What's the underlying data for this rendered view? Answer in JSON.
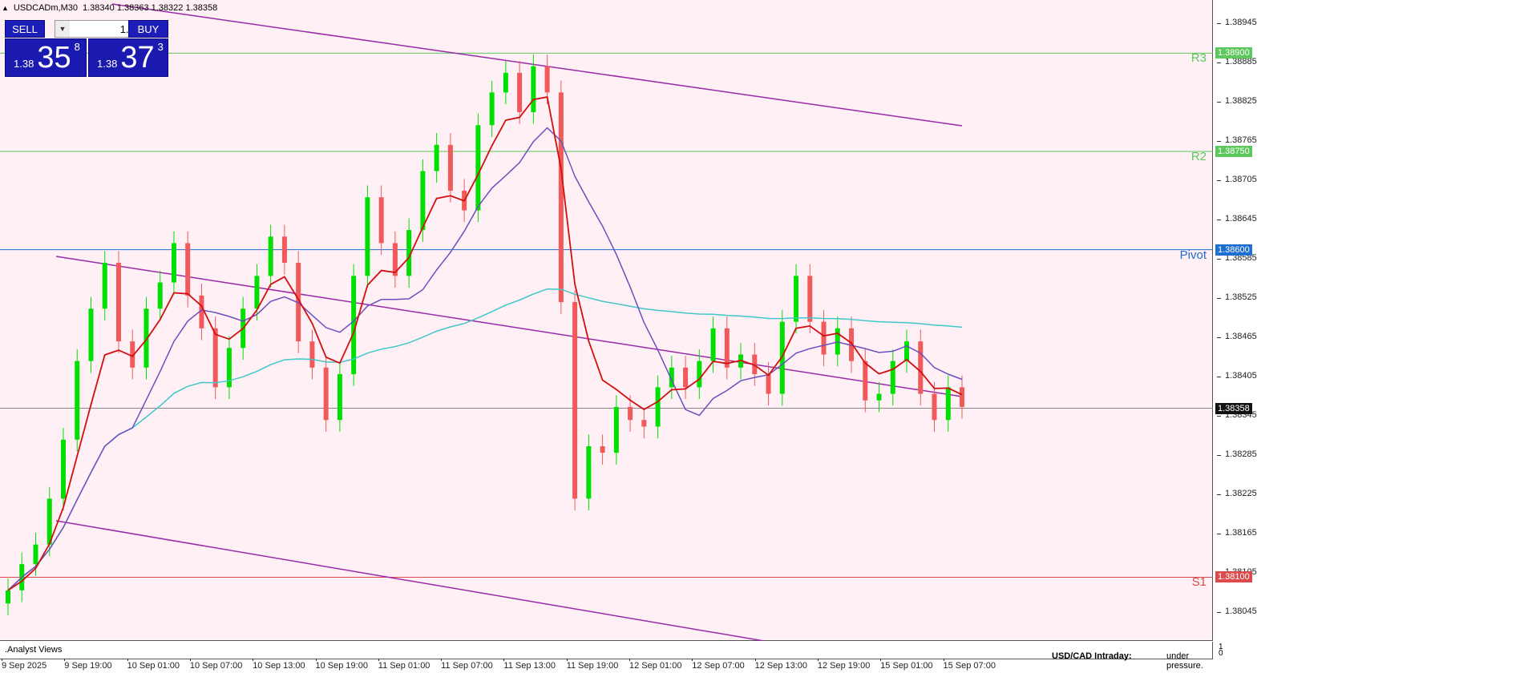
{
  "window": {
    "symbol_title": "USDCADm,M30",
    "ohlc": "1.38340 1.38363 1.38322 1.38358"
  },
  "trade_panel": {
    "sell_label": "SELL",
    "buy_label": "BUY",
    "lot_value": "1.00",
    "sell_quote": {
      "prefix": "1.38",
      "big": "35",
      "sup": "8"
    },
    "buy_quote": {
      "prefix": "1.38",
      "big": "37",
      "sup": "3"
    }
  },
  "price_axis": {
    "ticks": [
      "1.38945",
      "1.38885",
      "1.38825",
      "1.38765",
      "1.38705",
      "1.38645",
      "1.38585",
      "1.38525",
      "1.38465",
      "1.38405",
      "1.38345",
      "1.38285",
      "1.38225",
      "1.38165",
      "1.38105",
      "1.38045"
    ]
  },
  "levels": [
    {
      "name": "R3",
      "price": "1.38900",
      "color": "#5dc85d"
    },
    {
      "name": "R2",
      "price": "1.38750",
      "color": "#5dc85d"
    },
    {
      "name": "Pivot",
      "price": "1.38600",
      "color": "#1e6fd0"
    },
    {
      "name": "S1",
      "price": "1.38100",
      "color": "#dc4b4b"
    }
  ],
  "current_price": "1.38358",
  "time_axis": {
    "labels": [
      "9 Sep 2025",
      "9 Sep 19:00",
      "10 Sep 01:00",
      "10 Sep 07:00",
      "10 Sep 13:00",
      "10 Sep 19:00",
      "11 Sep 01:00",
      "11 Sep 07:00",
      "11 Sep 13:00",
      "11 Sep 19:00",
      "12 Sep 01:00",
      "12 Sep 07:00",
      "12 Sep 13:00",
      "12 Sep 19:00",
      "15 Sep 01:00",
      "15 Sep 07:00"
    ]
  },
  "sub_panel": {
    "label": ".Analyst Views",
    "news_title": "USD/CAD Intraday:",
    "news_text": "under pressure.",
    "scale_top": "1",
    "scale_bottom": "0"
  },
  "colors": {
    "bull": "#00e000",
    "bear": "#f05a5a",
    "ema_fast": "#d01010",
    "ma_mid": "#6a4fc0",
    "ma_slow": "#40c8c8",
    "channel": "#9a2aa8",
    "background": "#fff0f5"
  },
  "chart_data": {
    "type": "candlestick",
    "timeframe": "M30",
    "y_range": [
      1.38015,
      1.38975
    ],
    "close_series": [
      1.3808,
      1.3812,
      1.3815,
      1.3822,
      1.3831,
      1.3843,
      1.3851,
      1.3858,
      1.3846,
      1.3842,
      1.3851,
      1.3855,
      1.3861,
      1.3853,
      1.3848,
      1.3839,
      1.3845,
      1.3851,
      1.3856,
      1.3862,
      1.3858,
      1.3846,
      1.3842,
      1.3834,
      1.3841,
      1.3856,
      1.3868,
      1.3861,
      1.3856,
      1.3863,
      1.3872,
      1.3876,
      1.3869,
      1.3866,
      1.3879,
      1.3884,
      1.3887,
      1.3881,
      1.3888,
      1.3884,
      1.3852,
      1.3822,
      1.383,
      1.3829,
      1.3836,
      1.3834,
      1.3833,
      1.3839,
      1.3842,
      1.3839,
      1.3843,
      1.3848,
      1.3842,
      1.3844,
      1.3841,
      1.3838,
      1.3849,
      1.3856,
      1.3849,
      1.3844,
      1.3848,
      1.3843,
      1.3837,
      1.3838,
      1.3843,
      1.3846,
      1.3838,
      1.3834,
      1.3839,
      1.3836
    ]
  }
}
